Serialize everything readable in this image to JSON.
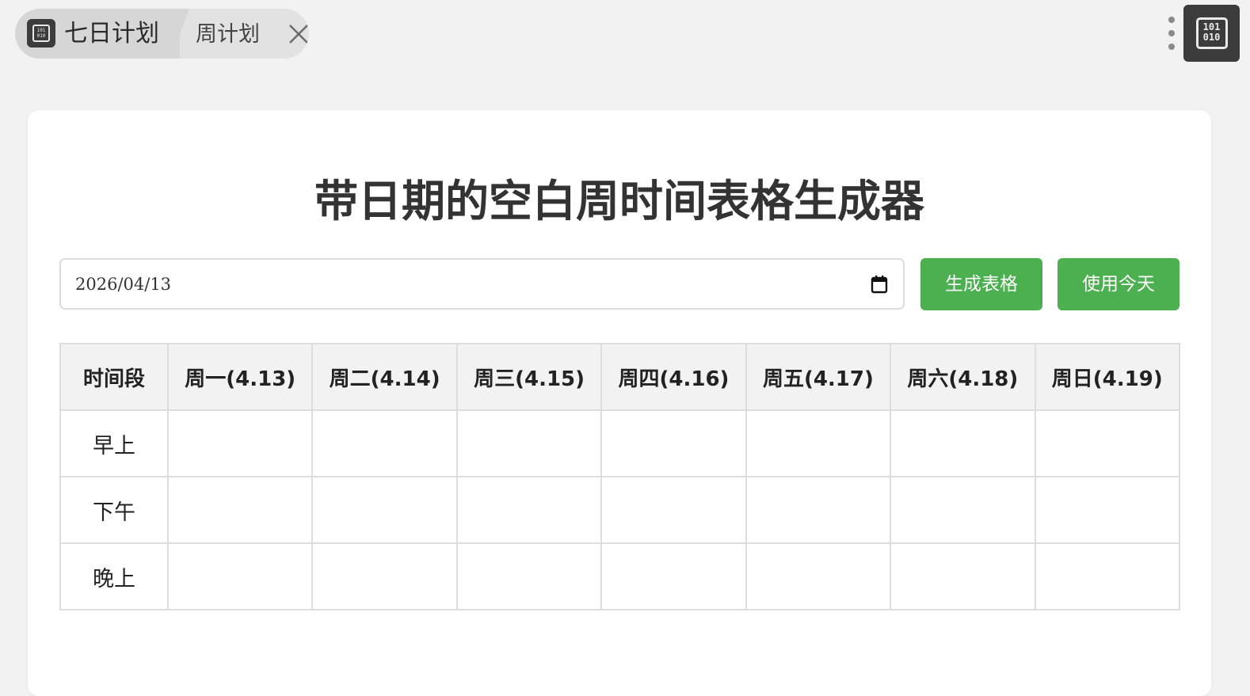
{
  "topbar": {
    "app_title": "七日计划",
    "tab_label": "周计划",
    "app_icon_glyph": "101 010",
    "corner_icon_glyph": "101 010"
  },
  "page": {
    "title": "带日期的空白周时间表格生成器"
  },
  "controls": {
    "date_value": "2026/04/13",
    "generate_label": "生成表格",
    "today_label": "使用今天"
  },
  "table": {
    "headers": [
      "时间段",
      "周一(4.13)",
      "周二(4.14)",
      "周三(4.15)",
      "周四(4.16)",
      "周五(4.17)",
      "周六(4.18)",
      "周日(4.19)"
    ],
    "rows": [
      "早上",
      "下午",
      "晚上"
    ]
  },
  "colors": {
    "accent_green": "#4caf50",
    "header_bg": "#f2f2f2",
    "border": "#dddddd",
    "dark_icon_bg": "#3c3c3c"
  }
}
